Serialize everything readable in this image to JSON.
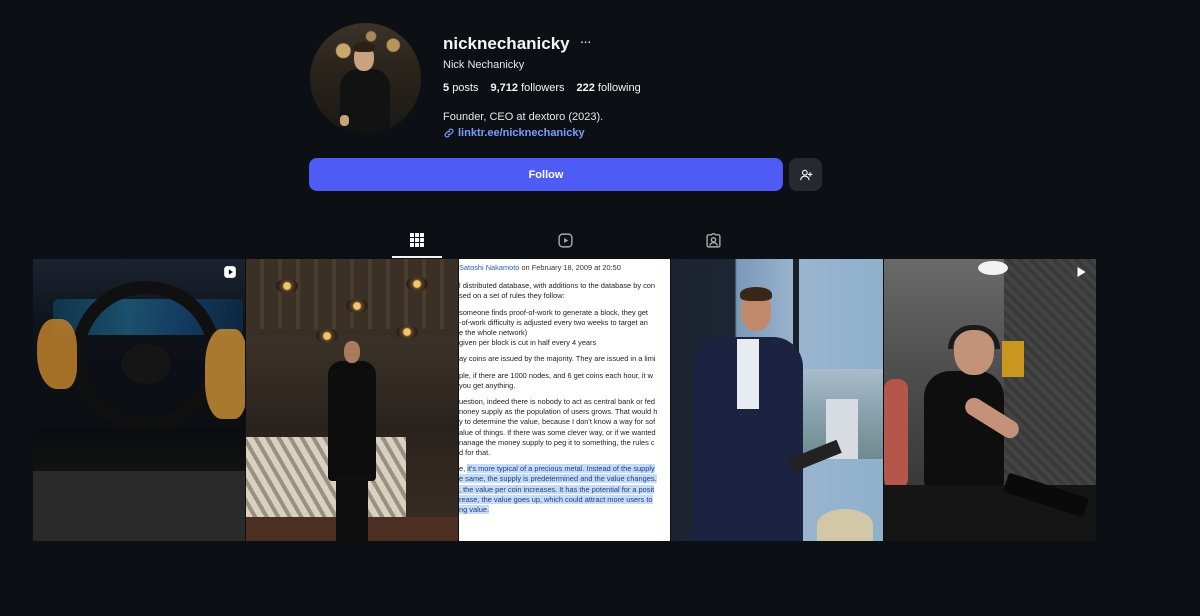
{
  "profile": {
    "username": "nicknechanicky",
    "more_label": "···",
    "full_name": "Nick Nechanicky",
    "stats": {
      "posts_count": "5",
      "posts_label": "posts",
      "followers_count": "9,712",
      "followers_label": "followers",
      "following_count": "222",
      "following_label": "following"
    },
    "bio": "Founder, CEO at dextoro (2023).",
    "link": "linktr.ee/nicknechanicky"
  },
  "actions": {
    "follow_label": "Follow",
    "suggest_icon": "person-add-icon"
  },
  "tabs": [
    {
      "id": "posts",
      "icon": "grid-icon",
      "active": true
    },
    {
      "id": "reels",
      "icon": "reels-icon",
      "active": false
    },
    {
      "id": "tagged",
      "icon": "tagged-icon",
      "active": false
    }
  ],
  "posts": [
    {
      "kind": "video",
      "badge_icon": "reel-play-icon",
      "subject": "steering-wheel"
    },
    {
      "kind": "image",
      "subject": "man-on-terrace"
    },
    {
      "kind": "image",
      "subject": "text-screenshot",
      "text": {
        "header_author": "Satoshi Nakamoto",
        "header_date": " on February 18, 2009 at 20:50",
        "lines": [
          "l distributed database, with additions to the database by con",
          "sed on a set of rules they follow:",
          "",
          "someone finds proof-of-work to generate a block, they get",
          "-of-work difficulty is adjusted every two weeks to target an",
          "e the whole network)",
          "given per block is cut in half every 4 years",
          "",
          "ay coins are issued by the majority. They are issued in a limi",
          "",
          "ple, if there are 1000 nodes, and 6 get coins each hour, it w",
          " you get anything.",
          "",
          "uestion, indeed there is nobody to act as central bank or fed",
          "noney supply as the population of users grows. That would h",
          "y to determine the value, because I don't know a way for sof",
          "alue of things. If there was some clever way, or if we wanted",
          "nanage the money supply to peg it to something, the rules c",
          "d for that."
        ],
        "highlight_prefix": "e, ",
        "highlight_lines": [
          "it's more typical of a precious metal. Instead of the supply",
          "e same, the supply is predetermined and the value changes.",
          ", the value per coin increases. It has the potential for a posit",
          "rease, the value goes up, which could attract more users to",
          "ng value."
        ]
      }
    },
    {
      "kind": "image",
      "subject": "man-in-suit-window"
    },
    {
      "kind": "video",
      "badge_icon": "play-icon",
      "subject": "shooting-range"
    }
  ]
}
